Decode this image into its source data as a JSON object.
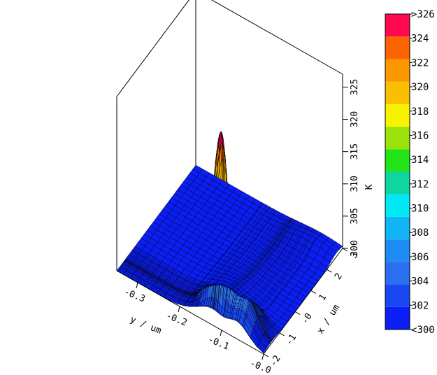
{
  "chart_data": {
    "type": "surface3d",
    "title": "",
    "xlabel": "x / um",
    "ylabel": "y / um",
    "zlabel": "K",
    "xlim": [
      -2,
      3
    ],
    "ylim": [
      -0.35,
      0.0
    ],
    "zlim": [
      300,
      327
    ],
    "x_ticks": [
      "-2",
      "-1",
      "-0",
      "1",
      "2",
      "3"
    ],
    "y_ticks": [
      "-0.0",
      "-0.1",
      "-0.2",
      "-0.3"
    ],
    "z_ticks": [
      "300",
      "305",
      "310",
      "315",
      "320",
      "325"
    ],
    "peak": {
      "x": -1.5,
      "y": -0.12,
      "z": 326
    },
    "base_level": 300,
    "colorbar": {
      "levels": [
        "<300",
        "302",
        "304",
        "306",
        "308",
        "310",
        "312",
        "314",
        "316",
        "318",
        "320",
        "322",
        "324",
        ">326"
      ],
      "colors": [
        "#0a1ef5",
        "#1947f2",
        "#2a6ff0",
        "#1e8cf5",
        "#11b4f5",
        "#00e8f5",
        "#0dd6a0",
        "#22e418",
        "#9be20c",
        "#f8f400",
        "#f9bf00",
        "#fb9800",
        "#fb6400",
        "#ff0a4e"
      ]
    }
  }
}
